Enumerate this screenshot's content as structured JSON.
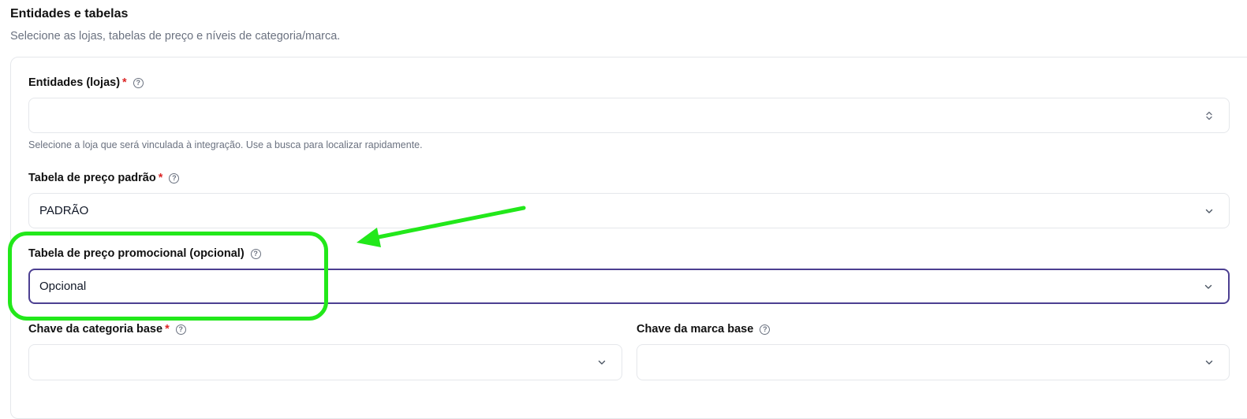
{
  "section": {
    "title": "Entidades e tabelas",
    "subtitle": "Selecione as lojas, tabelas de preço e níveis de categoria/marca."
  },
  "fields": {
    "entidades": {
      "label": "Entidades (lojas)",
      "required": "*",
      "value": "",
      "hint": "Selecione a loja que será vinculada à integração. Use a busca para localizar rapidamente."
    },
    "tabela_padrao": {
      "label": "Tabela de preço padrão",
      "required": "*",
      "value": "PADRÃO"
    },
    "tabela_promocional": {
      "label": "Tabela de preço promocional (opcional)",
      "value": "Opcional"
    },
    "chave_categoria": {
      "label": "Chave da categoria base",
      "required": "*",
      "value": ""
    },
    "chave_marca": {
      "label": "Chave da marca base",
      "value": ""
    }
  },
  "help_glyph": "?",
  "colors": {
    "accent_focus": "#4c3f91",
    "required": "#dc2626",
    "annotation": "#22e81a"
  }
}
